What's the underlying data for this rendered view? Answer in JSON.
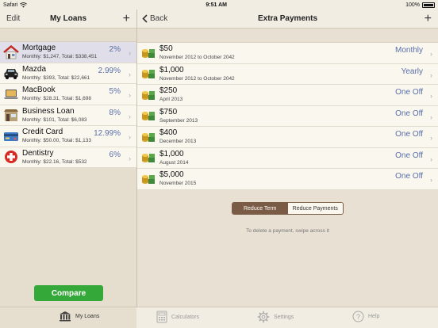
{
  "status": {
    "carrier": "Safari",
    "time": "9:51 AM",
    "battery": "100%"
  },
  "nav_left": {
    "edit": "Edit",
    "title": "My Loans",
    "add": "+"
  },
  "nav_right": {
    "back": "Back",
    "title": "Extra Payments",
    "add": "+"
  },
  "loans": [
    {
      "name": "Mortgage",
      "rate": "2%",
      "detail": "Monthly: $1,247, Total: $338,451",
      "icon": "house-icon"
    },
    {
      "name": "Mazda",
      "rate": "2.99%",
      "detail": "Monthly: $393, Total: $22,661",
      "icon": "car-icon"
    },
    {
      "name": "MacBook",
      "rate": "5%",
      "detail": "Monthly: $28.31, Total: $1,698",
      "icon": "laptop-icon"
    },
    {
      "name": "Business Loan",
      "rate": "8%",
      "detail": "Monthly: $101, Total: $6,083",
      "icon": "store-icon"
    },
    {
      "name": "Credit Card",
      "rate": "12.99%",
      "detail": "Monthly: $50.00, Total: $1,133",
      "icon": "credit-card-icon"
    },
    {
      "name": "Dentistry",
      "rate": "6%",
      "detail": "Monthly: $22.16, Total: $532",
      "icon": "medical-cross-icon"
    }
  ],
  "compare_label": "Compare",
  "payments": [
    {
      "amount": "$50",
      "range": "November 2012 to October 2042",
      "freq": "Monthly"
    },
    {
      "amount": "$1,000",
      "range": "November 2012 to October 2042",
      "freq": "Yearly"
    },
    {
      "amount": "$250",
      "range": "April 2013",
      "freq": "One Off"
    },
    {
      "amount": "$750",
      "range": "September 2013",
      "freq": "One Off"
    },
    {
      "amount": "$400",
      "range": "December 2013",
      "freq": "One Off"
    },
    {
      "amount": "$1,000",
      "range": "August 2014",
      "freq": "One Off"
    },
    {
      "amount": "$5,000",
      "range": "November 2015",
      "freq": "One Off"
    }
  ],
  "segment": {
    "reduce_term": "Reduce Term",
    "reduce_payments": "Reduce Payments"
  },
  "hint": "To delete a payment, swipe across it",
  "tabs": {
    "my_loans": "My Loans",
    "calculators": "Calculators",
    "settings": "Settings",
    "help": "Help"
  },
  "colors": {
    "accent_blue": "#5a6fa8",
    "compare_green": "#35a83a",
    "segment_brown": "#7a5b45"
  }
}
